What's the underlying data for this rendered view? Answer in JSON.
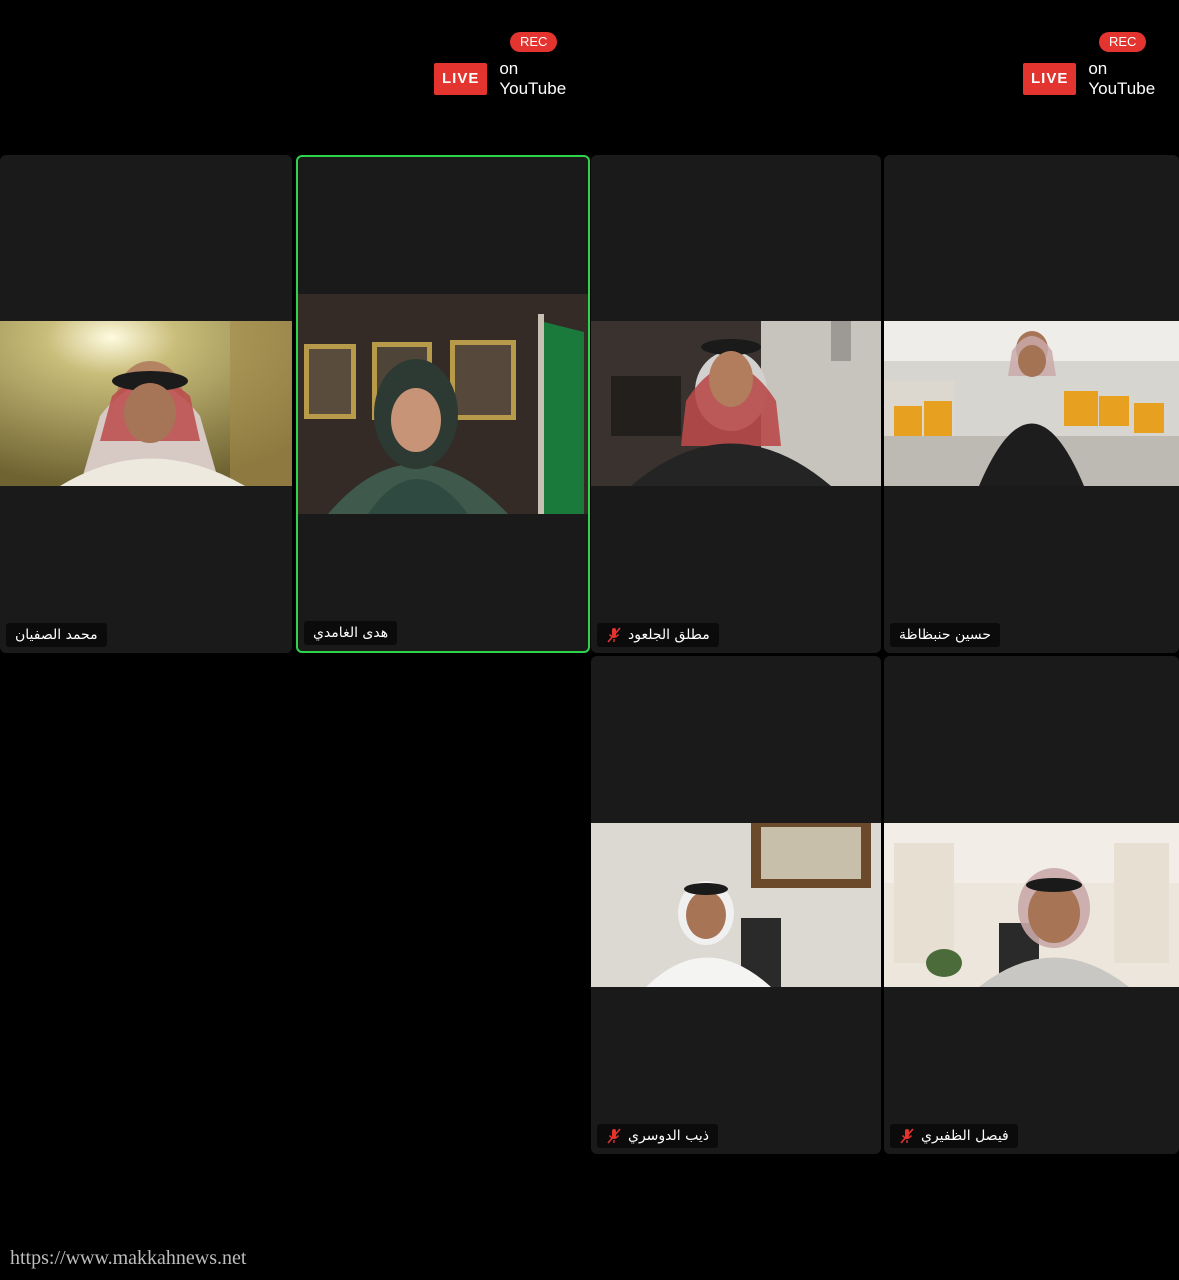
{
  "broadcast": {
    "left": {
      "rec": "REC",
      "live": "LIVE",
      "platform": "on YouTube"
    },
    "right": {
      "rec": "REC",
      "live": "LIVE",
      "platform": "on YouTube"
    }
  },
  "participants": [
    {
      "name": "محمد الصفيان",
      "muted": false,
      "active": false
    },
    {
      "name": "هدى الغامدي",
      "muted": false,
      "active": true
    },
    {
      "name": "مطلق الجلعود",
      "muted": true,
      "active": false
    },
    {
      "name": "حسين حنبظاظة",
      "muted": false,
      "active": false
    },
    {
      "name": "ذيب الدوسري",
      "muted": true,
      "active": false
    },
    {
      "name": "فيصل الظفيري",
      "muted": true,
      "active": false
    }
  ],
  "watermark": "https://www.makkahnews.net",
  "colors": {
    "live_red": "#e3342f",
    "active_speaker_border": "#2fd44a",
    "tile_background": "#1a1a1a"
  }
}
